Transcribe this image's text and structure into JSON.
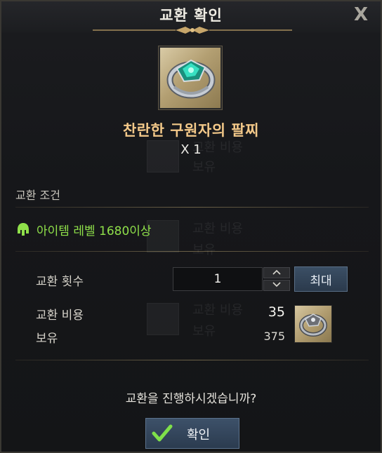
{
  "dialog": {
    "title": "교환 확인",
    "close_label": "X"
  },
  "item": {
    "name": "찬란한 구원자의 팔찌",
    "quantity": "X 1",
    "icon": "bracelet-icon"
  },
  "conditions": {
    "section_label": "교환 조건",
    "requirement": "아이템 레벨 1680이상",
    "requirement_icon": "helmet-icon",
    "requirement_color": "#8fe04a"
  },
  "exchange": {
    "count_label": "교환 횟수",
    "count_value": "1",
    "max_label": "최대",
    "cost_label": "교환 비용",
    "cost_value": "35",
    "owned_label": "보유",
    "owned_value": "375",
    "currency_icon": "bracelet-material-icon"
  },
  "footer": {
    "question": "교환을 진행하시겠습니까?",
    "confirm_label": "확인"
  },
  "background_ghost": {
    "cost_label": "교환 비용",
    "owned_label": "보유"
  }
}
